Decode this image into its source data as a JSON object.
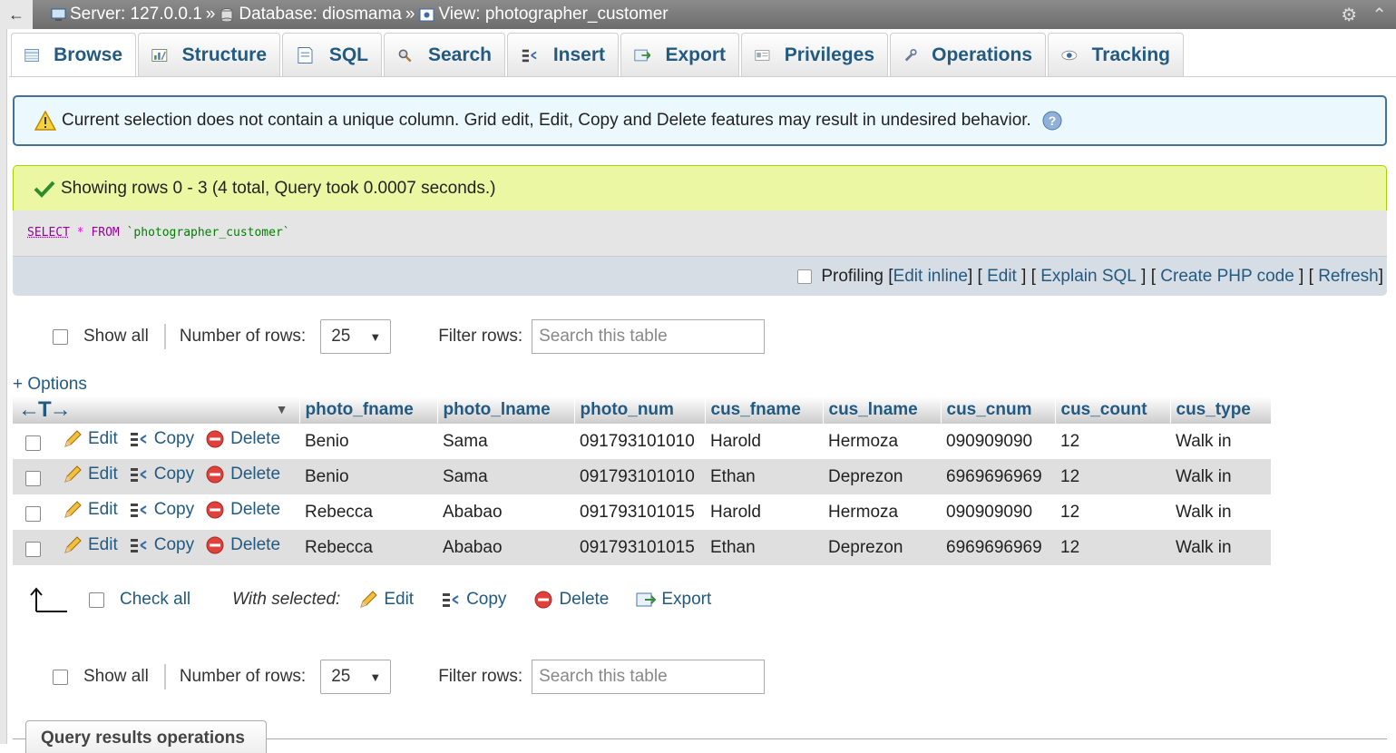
{
  "topbar": {
    "back_arrow": "←",
    "server": "Server: 127.0.0.1",
    "database": "Database: diosmama",
    "view": "View: photographer_customer",
    "sep": "»",
    "icons": [
      "gear-icon",
      "collapse-icon"
    ]
  },
  "tabs": [
    {
      "label": "Browse",
      "icon": "browse-icon"
    },
    {
      "label": "Structure",
      "icon": "structure-icon"
    },
    {
      "label": "SQL",
      "icon": "sql-icon"
    },
    {
      "label": "Search",
      "icon": "search-icon"
    },
    {
      "label": "Insert",
      "icon": "insert-icon"
    },
    {
      "label": "Export",
      "icon": "export-icon"
    },
    {
      "label": "Privileges",
      "icon": "privileges-icon"
    },
    {
      "label": "Operations",
      "icon": "operations-icon"
    },
    {
      "label": "Tracking",
      "icon": "tracking-icon"
    }
  ],
  "notice": {
    "text": "Current selection does not contain a unique column. Grid edit, Edit, Copy and Delete features may result in undesired behavior."
  },
  "success": {
    "text": "Showing rows 0 - 3 (4 total, Query took 0.0007 seconds.)"
  },
  "sql": {
    "select": "SELECT",
    "star": "*",
    "from": "FROM",
    "table": "`photographer_customer`"
  },
  "sql_actions": {
    "profiling": "Profiling",
    "edit_inline": "Edit inline",
    "edit": "Edit",
    "explain": "Explain SQL",
    "php": "Create PHP code",
    "refresh": "Refresh"
  },
  "nav": {
    "show_all": "Show all",
    "num_rows_label": "Number of rows:",
    "num_rows_value": "25",
    "filter_label": "Filter rows:",
    "filter_placeholder": "Search this table"
  },
  "options_link": "+ Options",
  "table": {
    "arrows": "←T→",
    "columns": [
      "photo_fname",
      "photo_lname",
      "photo_num",
      "cus_fname",
      "cus_lname",
      "cus_cnum",
      "cus_count",
      "cus_type"
    ],
    "actions": {
      "edit": "Edit",
      "copy": "Copy",
      "delete": "Delete"
    },
    "rows": [
      [
        "Benio",
        "Sama",
        "091793101010",
        "Harold",
        "Hermoza",
        "090909090",
        "12",
        "Walk in"
      ],
      [
        "Benio",
        "Sama",
        "091793101010",
        "Ethan",
        "Deprezon",
        "6969696969",
        "12",
        "Walk in"
      ],
      [
        "Rebecca",
        "Ababao",
        "091793101015",
        "Harold",
        "Hermoza",
        "090909090",
        "12",
        "Walk in"
      ],
      [
        "Rebecca",
        "Ababao",
        "091793101015",
        "Ethan",
        "Deprezon",
        "6969696969",
        "12",
        "Walk in"
      ]
    ]
  },
  "with_selected": {
    "check_all": "Check all",
    "label": "With selected:",
    "edit": "Edit",
    "copy": "Copy",
    "delete": "Delete",
    "export": "Export"
  },
  "query_results_operations": "Query results operations"
}
